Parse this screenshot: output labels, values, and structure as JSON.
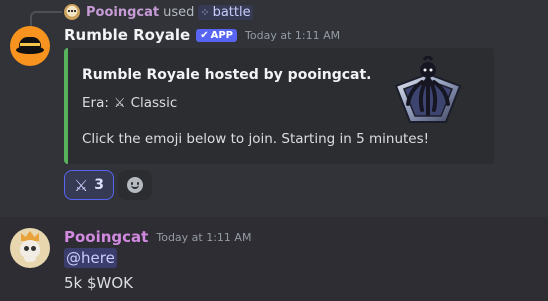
{
  "interaction": {
    "user": "Pooingcat",
    "used_word": "used",
    "command": "battle"
  },
  "bot_message": {
    "author": "Rumble Royale",
    "badge": "APP",
    "timestamp": "Today at 1:11 AM",
    "embed": {
      "title": "Rumble Royale hosted by pooingcat.",
      "era_label": "Era:",
      "era_icon": "crossed-swords-icon",
      "era_value": "Classic",
      "description": "Click the emoji below to join. Starting in 5 minutes!",
      "accent_color": "#57b45c"
    },
    "reactions": [
      {
        "emoji": "crossed-swords-icon",
        "count": "3"
      }
    ]
  },
  "user_message": {
    "author": "Pooingcat",
    "timestamp": "Today at 1:11 AM",
    "mention": "@here",
    "text": "5k $WOK"
  },
  "colors": {
    "background": "#313338",
    "embed_bg": "#2b2d31",
    "brand": "#5865f2",
    "user_name": "#d18ae0"
  }
}
